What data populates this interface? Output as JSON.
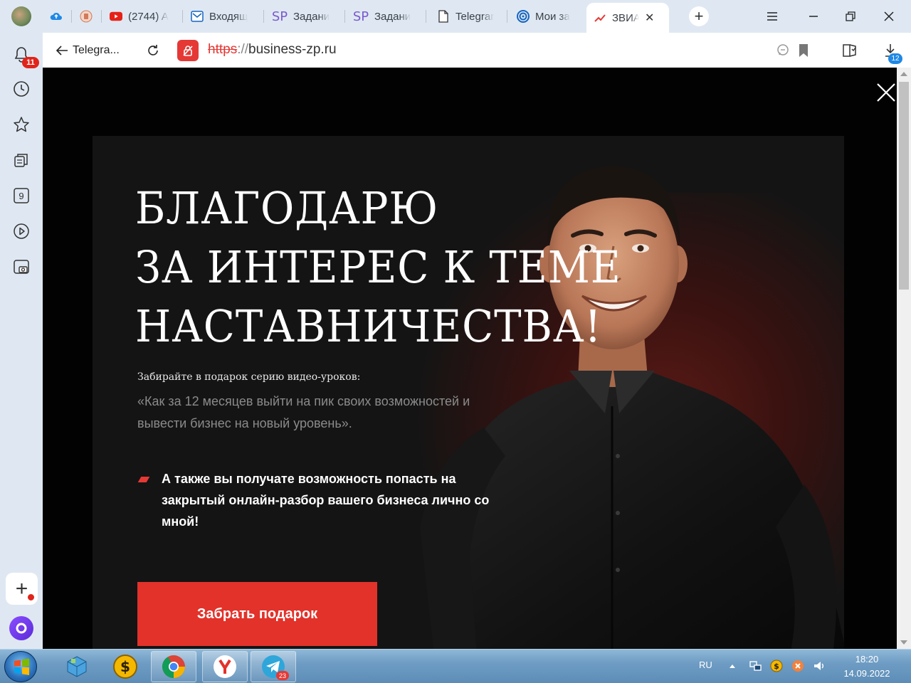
{
  "browser": {
    "tabs": [
      {
        "label": "",
        "icon": "cloud-upload-icon"
      },
      {
        "label": "",
        "icon": "app-icon"
      },
      {
        "label": "(2744) A",
        "icon": "youtube-icon"
      },
      {
        "label": "Входящ",
        "icon": "mail-icon"
      },
      {
        "label": "Задани",
        "icon": "sp-icon"
      },
      {
        "label": "Задани",
        "icon": "sp-icon"
      },
      {
        "label": "Telegrar",
        "icon": "document-icon"
      },
      {
        "label": "Мои за",
        "icon": "target-icon"
      },
      {
        "label": "ЗВИА",
        "icon": "chart-icon",
        "active": true
      }
    ],
    "sidebar": {
      "notifications_badge": "11",
      "tabs_count": "9"
    },
    "address": {
      "back_label": "Telegra...",
      "protocol": "https",
      "host_sep": "://",
      "host": "business-zp.ru",
      "downloads_badge": "12"
    }
  },
  "page": {
    "headline": [
      "БЛАГОДАРЮ",
      "ЗА ИНТЕРЕС К ТЕМЕ",
      "НАСТАВНИЧЕСТВА!"
    ],
    "gift_intro": "Забирайте в подарок серию видео-уроков:",
    "gift_series": "«Как за 12 месяцев выйти на пик своих возможностей и вывести бизнес на новый уровень».",
    "bonus": "А также вы получате возможность попасть на закрытый онлайн-разбор вашего бизнеса лично со мной!",
    "cta": "Забрать подарок",
    "accent_color": "#e2322a"
  },
  "taskbar": {
    "telegram_badge": "23",
    "language": "RU",
    "time": "18:20",
    "date": "14.09.2022"
  }
}
